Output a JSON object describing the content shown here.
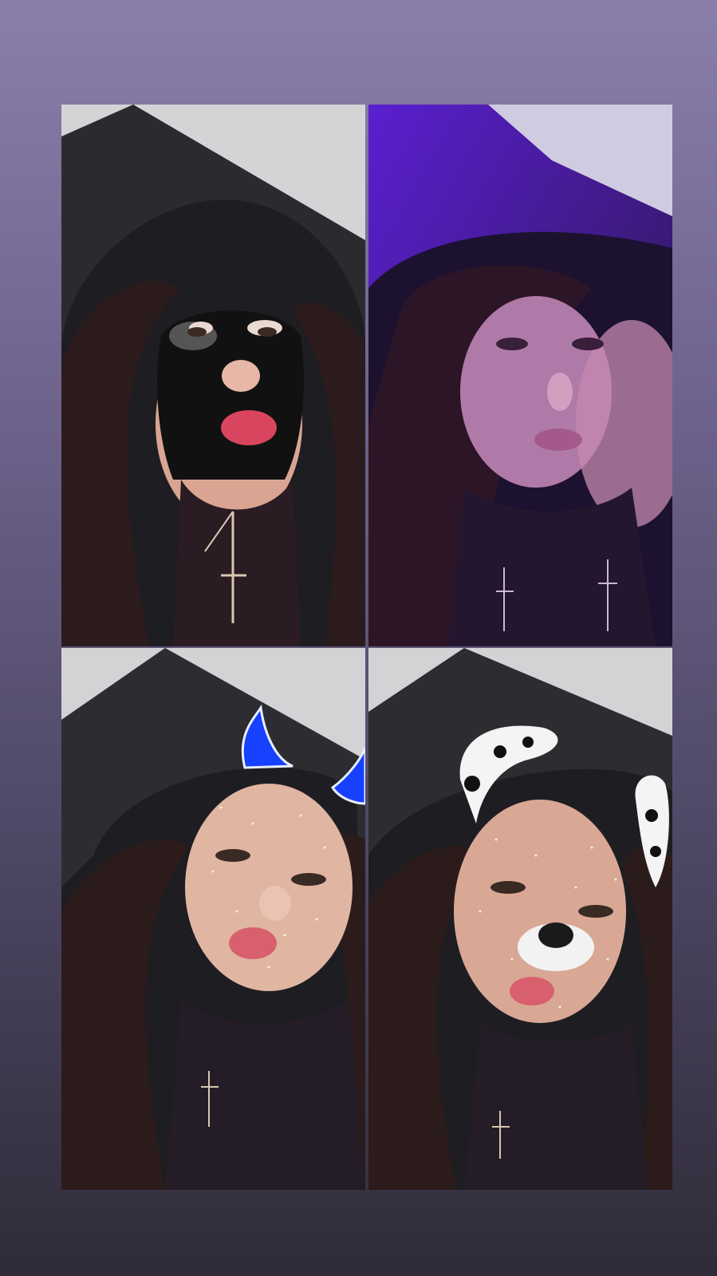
{
  "story": {
    "tiles": [
      {
        "filter_name": "charcoal-mask-filter"
      },
      {
        "filter_name": "purple-double-exposure-filter"
      },
      {
        "filter_name": "blue-devil-horns-filter"
      },
      {
        "filter_name": "dalmatian-dog-filter"
      }
    ]
  },
  "colors": {
    "background_top": "#8a7fa8",
    "background_bottom": "#2f2c38",
    "hair": "#2a1d1e",
    "hood": "#1d1c22",
    "horn_glow": "#2f6bff",
    "purple_tint": "#6a2fd6"
  }
}
